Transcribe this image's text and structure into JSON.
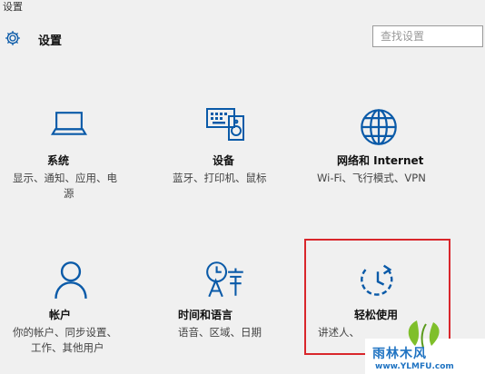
{
  "window": {
    "title": "设置"
  },
  "header": {
    "title": "设置",
    "icon": "gear-icon"
  },
  "search": {
    "placeholder": "查找设置",
    "value": ""
  },
  "tiles": [
    {
      "id": "system",
      "icon": "laptop-icon",
      "title": "系统",
      "desc": [
        "显示、通知、应用、电",
        "源"
      ]
    },
    {
      "id": "devices",
      "icon": "keyboard-speaker-icon",
      "title": "设备",
      "desc": [
        "蓝牙、打印机、鼠标"
      ]
    },
    {
      "id": "network",
      "icon": "globe-icon",
      "title": "网络和 Internet",
      "desc": [
        "Wi-Fi、飞行模式、VPN"
      ]
    },
    {
      "id": "accounts",
      "icon": "person-icon",
      "title": "帐户",
      "desc": [
        "你的帐户、同步设置、",
        "工作、其他用户"
      ]
    },
    {
      "id": "time-language",
      "icon": "clock-language-icon",
      "title": "时间和语言",
      "desc": [
        "语音、区域、日期"
      ]
    },
    {
      "id": "ease-of-access",
      "icon": "ease-of-access-icon",
      "title": "轻松使用",
      "desc": [
        "讲述人、"
      ]
    }
  ],
  "watermark": {
    "text": "雨林木风",
    "url": "www.YLMFU.com"
  },
  "colors": {
    "accent": "#0a5aa8",
    "highlight": "#d9262b",
    "watermark": "#1f73c2"
  }
}
